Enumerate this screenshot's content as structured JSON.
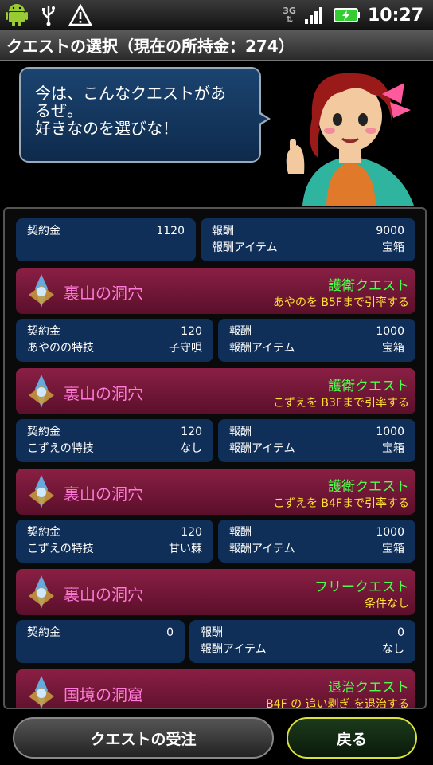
{
  "statusbar": {
    "network": "3G",
    "time": "10:27"
  },
  "title": "クエストの選択（現在の所持金：274）",
  "bubble": {
    "line1": "今は、こんなクエストがあ",
    "line2": "るぜ。",
    "line3": "好きなのを選びな！"
  },
  "labels": {
    "fee": "契約金",
    "reward": "報酬",
    "reward_item": "報酬アイテム"
  },
  "top_info": {
    "fee": "1120",
    "reward": "9000",
    "item": "宝箱"
  },
  "quests": [
    {
      "name": "裏山の洞穴",
      "type": "護衛クエスト",
      "condition": "あやのを B5Fまで引率する",
      "fee": "120",
      "skill_label": "あやのの特技",
      "skill": "子守唄",
      "reward": "1000",
      "item": "宝箱"
    },
    {
      "name": "裏山の洞穴",
      "type": "護衛クエスト",
      "condition": "こずえを B3Fまで引率する",
      "fee": "120",
      "skill_label": "こずえの特技",
      "skill": "なし",
      "reward": "1000",
      "item": "宝箱"
    },
    {
      "name": "裏山の洞穴",
      "type": "護衛クエスト",
      "condition": "こずえを B4Fまで引率する",
      "fee": "120",
      "skill_label": "こずえの特技",
      "skill": "甘い棘",
      "reward": "1000",
      "item": "宝箱"
    },
    {
      "name": "裏山の洞穴",
      "type": "フリークエスト",
      "condition": "条件なし",
      "fee": "0",
      "reward": "0",
      "item": "なし"
    },
    {
      "name": "国境の洞窟",
      "type": "退治クエスト",
      "condition": "B4F の 追い剥ぎ を退治する"
    }
  ],
  "buttons": {
    "accept": "クエストの受注",
    "back": "戻る"
  },
  "colors": {
    "quest_name": "#ff7ad8",
    "quest_type": "#4cff4c",
    "quest_condition": "#ffe033",
    "info_bg": "#0f2f58",
    "quest_bg": "#7a1a3c"
  }
}
